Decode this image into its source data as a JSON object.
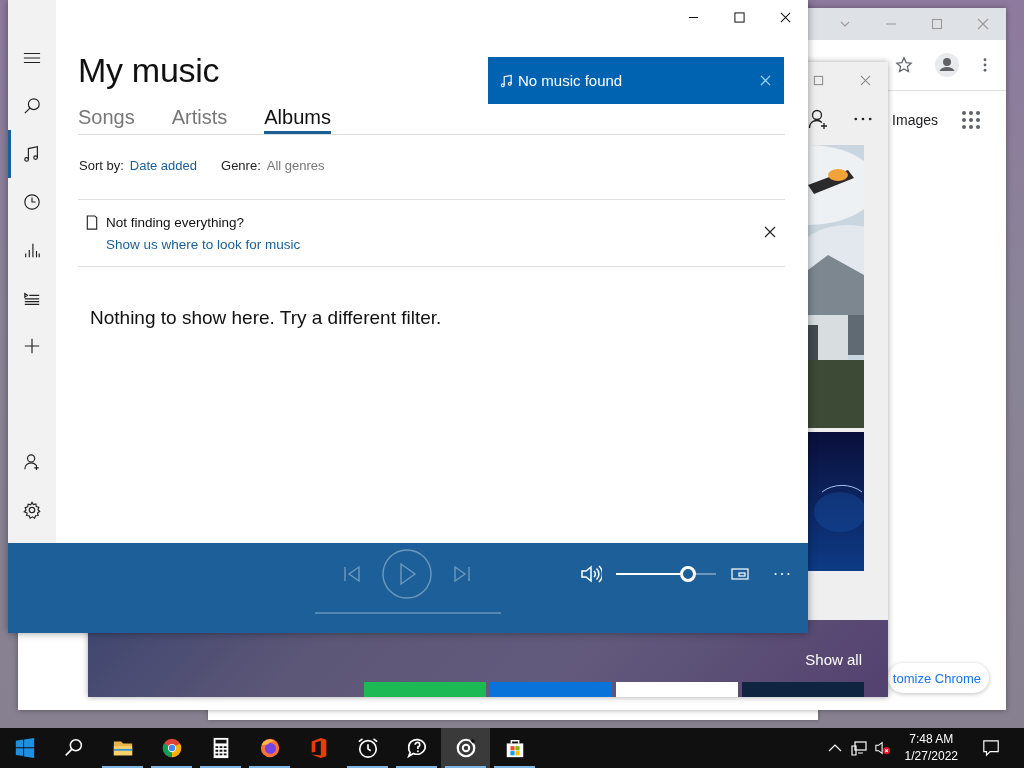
{
  "music_app": {
    "sidebar": {
      "top_items": [
        {
          "kind": "menu",
          "selected": false
        },
        {
          "kind": "search",
          "selected": false
        },
        {
          "kind": "music",
          "selected": true
        },
        {
          "kind": "recent",
          "selected": false
        },
        {
          "kind": "charts",
          "selected": false
        },
        {
          "kind": "playlists",
          "selected": false
        },
        {
          "kind": "add",
          "selected": false
        }
      ],
      "bottom_items": [
        {
          "kind": "account",
          "selected": false
        },
        {
          "kind": "settings",
          "selected": false
        }
      ]
    },
    "heading": "My music",
    "toast": {
      "text": "No music found"
    },
    "tabs": [
      {
        "label": "Songs",
        "selected": false
      },
      {
        "label": "Artists",
        "selected": false
      },
      {
        "label": "Albums",
        "selected": true
      }
    ],
    "filters": [
      {
        "label": "Sort by:",
        "value": "Date added",
        "kind": "link"
      },
      {
        "label": "Genre:",
        "value": "All genres",
        "kind": "plain"
      }
    ],
    "notice": {
      "title": "Not finding everything?",
      "link": "Show us where to look for music"
    },
    "empty_message": "Nothing to show here. Try a different filter.",
    "player": {
      "controls_disabled": true,
      "seek": {
        "level": 0
      },
      "volume": {
        "level": 0.72
      }
    }
  },
  "store_window": {
    "show_all": "Show all"
  },
  "chrome_window": {
    "images_link": "Images",
    "customize_button": "tomize Chrome"
  },
  "taskbar": {
    "apps": [
      {
        "kind": "start",
        "running": false,
        "selected": false
      },
      {
        "kind": "search",
        "running": false,
        "selected": false
      },
      {
        "kind": "folder",
        "running": true,
        "selected": false
      },
      {
        "kind": "chrome",
        "running": true,
        "selected": false
      },
      {
        "kind": "calculator",
        "running": true,
        "selected": false
      },
      {
        "kind": "firefox",
        "running": true,
        "selected": false
      },
      {
        "kind": "office",
        "running": false,
        "selected": false
      },
      {
        "kind": "alarm",
        "running": true,
        "selected": false
      },
      {
        "kind": "feedback",
        "running": true,
        "selected": false
      },
      {
        "kind": "groove",
        "running": true,
        "selected": true
      },
      {
        "kind": "store",
        "running": true,
        "selected": false
      }
    ],
    "clock": {
      "time": "7:48 AM",
      "date": "1/27/2022"
    }
  }
}
